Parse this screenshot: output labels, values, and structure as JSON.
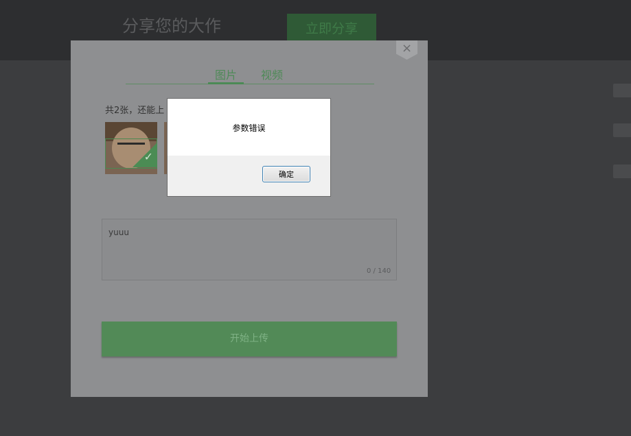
{
  "background": {
    "title": "分享您的大作",
    "share_button": "立即分享"
  },
  "upload_panel": {
    "tabs": [
      {
        "label": "图片"
      },
      {
        "label": "视频"
      }
    ],
    "count_text": "共2张，还能上",
    "description_value": "yuuu",
    "char_count": "0 / 140",
    "upload_button": "开始上传",
    "close_icon": "×"
  },
  "alert": {
    "message": "参数错误",
    "ok_label": "确定"
  },
  "colors": {
    "accent_green": "#4b8a55",
    "overlay": "#8e8f91"
  }
}
